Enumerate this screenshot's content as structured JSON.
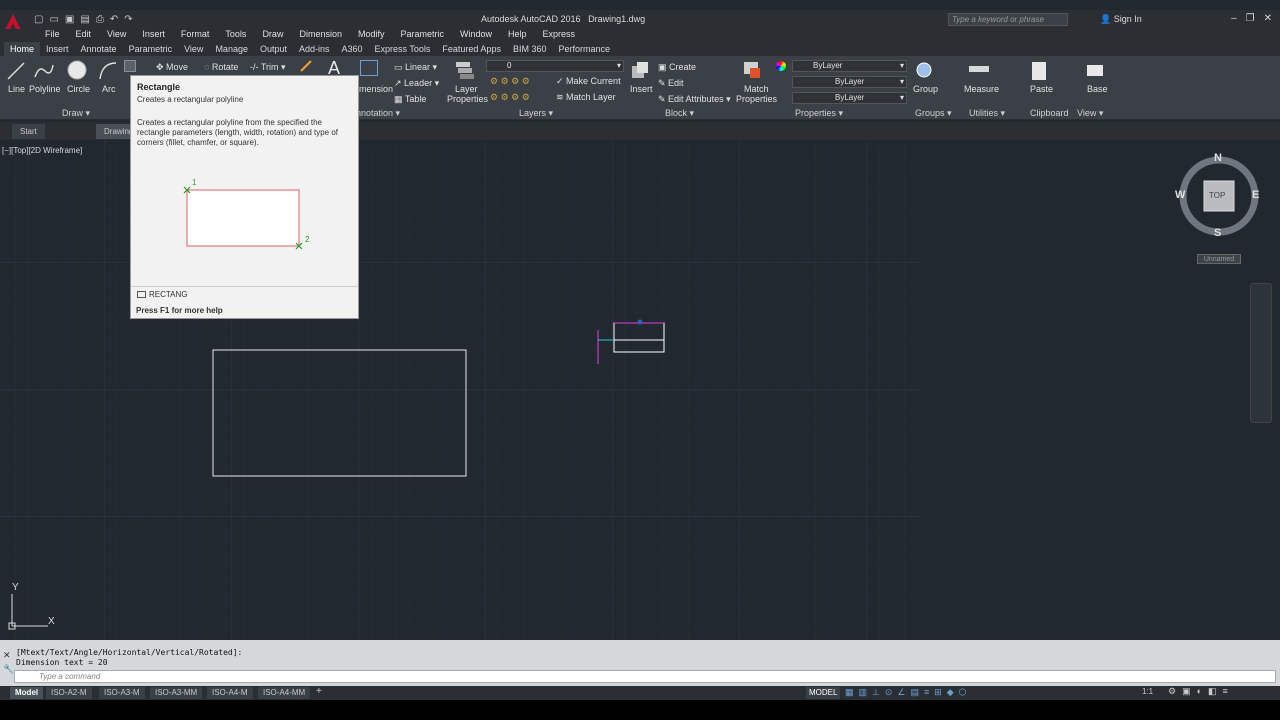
{
  "app": {
    "title": "Autodesk AutoCAD 2016",
    "file": "Drawing1.dwg",
    "search_placeholder": "Type a keyword or phrase",
    "signin": "Sign In"
  },
  "menu": [
    "File",
    "Edit",
    "View",
    "Insert",
    "Format",
    "Tools",
    "Draw",
    "Dimension",
    "Modify",
    "Parametric",
    "Window",
    "Help",
    "Express"
  ],
  "ribbon_tabs": [
    "Home",
    "Insert",
    "Annotate",
    "Parametric",
    "View",
    "Manage",
    "Output",
    "Add-ins",
    "A360",
    "Express Tools",
    "Featured Apps",
    "BIM 360",
    "Performance"
  ],
  "draw": {
    "line": "Line",
    "polyline": "Polyline",
    "circle": "Circle",
    "arc": "Arc",
    "panel": "Draw ▾"
  },
  "modify": {
    "move": "Move",
    "rotate": "Rotate",
    "trim": "Trim"
  },
  "annotation": {
    "dimension": "mension",
    "linear": "Linear",
    "leader": "Leader",
    "table": "Table",
    "panel": "nnotation ▾"
  },
  "layers": {
    "layer_properties_1": "Layer",
    "layer_properties_2": "Properties",
    "current_layer": "0",
    "make_current": "Make Current",
    "match_layer": "Match Layer",
    "panel": "Layers ▾"
  },
  "block": {
    "insert": "Insert",
    "create": "Create",
    "edit": "Edit",
    "edit_attributes": "Edit Attributes",
    "panel": "Block ▾"
  },
  "properties": {
    "match_1": "Match",
    "match_2": "Properties",
    "color": "ByLayer",
    "linetype": "ByLayer",
    "lineweight": "ByLayer",
    "panel": "Properties ▾"
  },
  "groups": {
    "group": "Group",
    "panel": "Groups ▾"
  },
  "utilities": {
    "measure": "Measure",
    "panel": "Utilities ▾"
  },
  "clipboard": {
    "paste": "Paste",
    "panel": "Clipboard"
  },
  "viewp": {
    "base": "Base",
    "panel": "View ▾"
  },
  "file_tabs": {
    "start": "Start",
    "drawing": "Drawing"
  },
  "viewport_label": "[−][Top][2D Wireframe]",
  "tooltip": {
    "title": "Rectangle",
    "subtitle": "Creates a rectangular polyline",
    "description": "Creates a rectangular polyline from the specified the rectangle parameters (length, width, rotation) and type of corners (fillet, chamfer, or square).",
    "p1": "1",
    "p2": "2",
    "command": "RECTANG",
    "help": "Press F1 for more help"
  },
  "viewcube": {
    "n": "N",
    "s": "S",
    "e": "E",
    "w": "W",
    "top": "TOP",
    "ucs": "Unnamed"
  },
  "ucs": {
    "x": "X",
    "y": "Y"
  },
  "command": {
    "line1": "[Mtext/Text/Angle/Horizontal/Vertical/Rotated]:",
    "line2": "Dimension text = 20",
    "placeholder": "Type a command"
  },
  "layout_tabs": [
    "Model",
    "ISO-A2-M",
    "ISO-A3-M",
    "ISO-A3-MM",
    "ISO-A4-M",
    "ISO-A4-MM"
  ],
  "status": {
    "model": "MODEL",
    "scale": "1:1"
  }
}
